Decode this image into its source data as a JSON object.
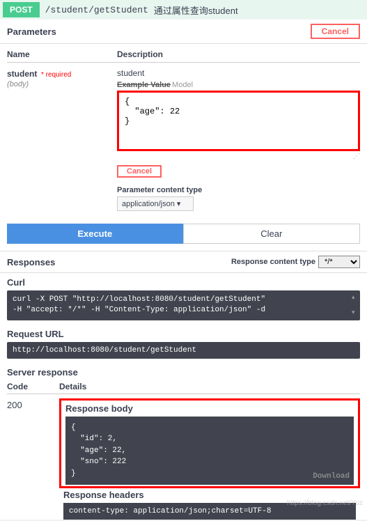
{
  "header": {
    "method": "POST",
    "path": "/student/getStudent",
    "summary": "通过属性查询student"
  },
  "parameters": {
    "title": "Parameters",
    "cancel": "Cancel",
    "columns": {
      "name": "Name",
      "description": "Description"
    },
    "param": {
      "name": "student",
      "required": "* required",
      "type": "(body)",
      "description": "student",
      "tab_example": "Example Value",
      "tab_model": "Model",
      "body_value": "{\n  \"age\": 22\n}",
      "cancel": "Cancel",
      "content_type_label": "Parameter content type",
      "content_type_value": "application/json"
    }
  },
  "buttons": {
    "execute": "Execute",
    "clear": "Clear"
  },
  "responses": {
    "title": "Responses",
    "content_type_label": "Response content type",
    "content_type_value": "*/*"
  },
  "curl": {
    "label": "Curl",
    "value": "curl -X POST \"http://localhost:8080/student/getStudent\"\n-H \"accept: */*\" -H \"Content-Type: application/json\" -d"
  },
  "request_url": {
    "label": "Request URL",
    "value": "http://localhost:8080/student/getStudent"
  },
  "server_response": {
    "label": "Server response",
    "code_label": "Code",
    "details_label": "Details",
    "code": "200",
    "body_label": "Response body",
    "body_value": "{\n  \"id\": 2,\n  \"age\": 22,\n  \"sno\": 222\n}",
    "download": "Download",
    "headers_label": "Response headers",
    "headers_value": " content-type: application/json;charset=UTF-8"
  },
  "watermark": "https://blog.csdn.net/Yuz"
}
